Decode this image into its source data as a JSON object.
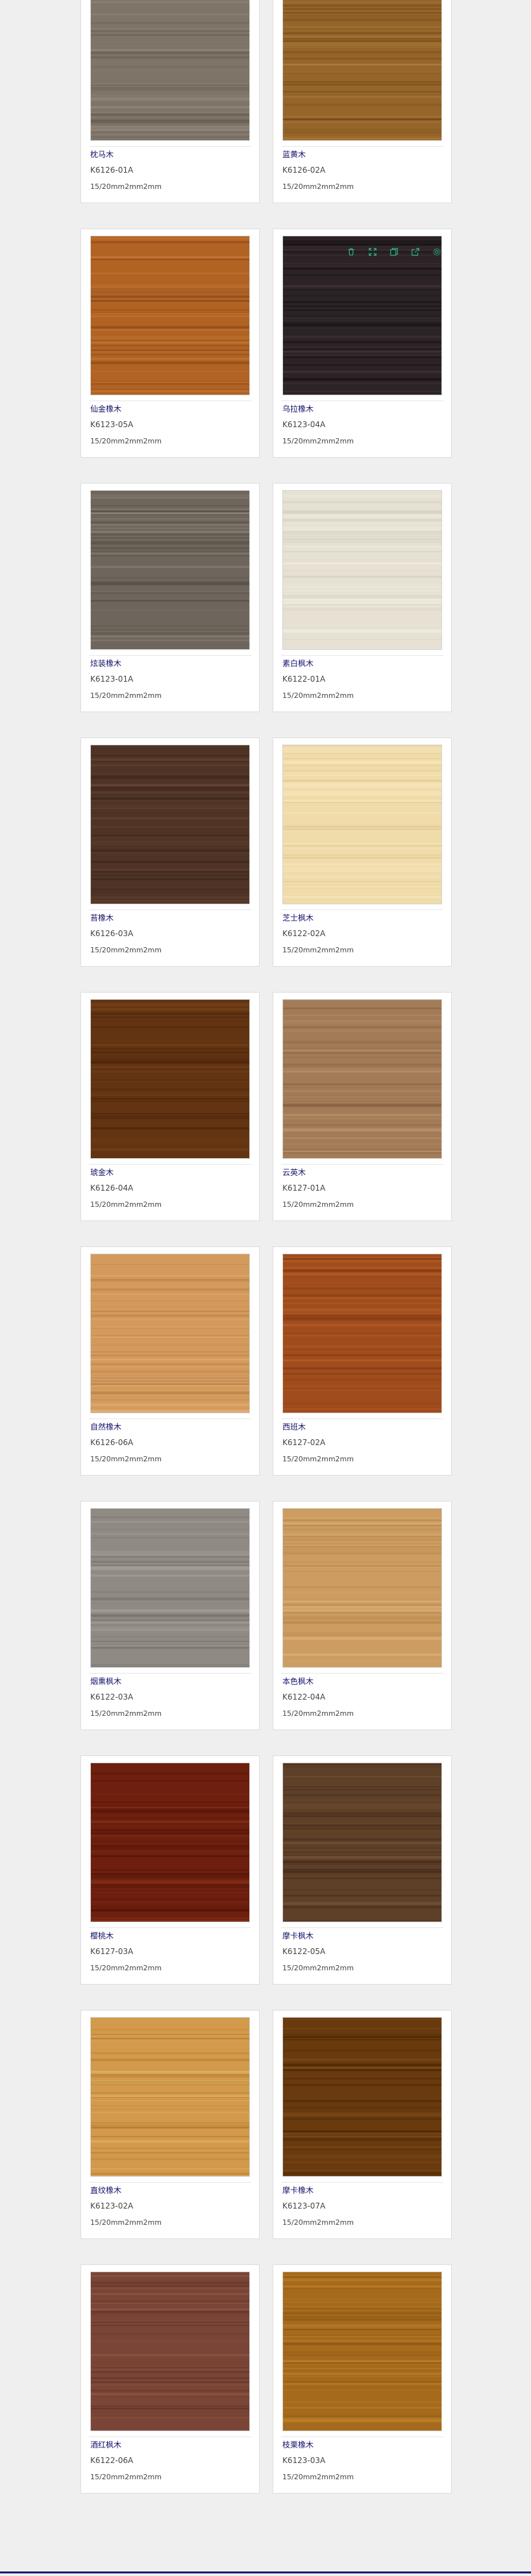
{
  "colors": {
    "accent": "#1c1a6e",
    "name_text": "#14126a",
    "toolbar_icon": "#2bb88a"
  },
  "toolbar": {
    "icons": [
      "trash-icon",
      "expand-icon",
      "copy-icon",
      "share-icon",
      "settings-icon"
    ]
  },
  "products": [
    {
      "name": "枕马木",
      "code": "K6126-01A",
      "spec": "15/20mm2mm2mm",
      "swatch": {
        "base": "#7e7468",
        "light": "#9a8f82",
        "dark": "#5e554b"
      }
    },
    {
      "name": "蓝黄木",
      "code": "K6126-02A",
      "spec": "15/20mm2mm2mm",
      "swatch": {
        "base": "#96652a",
        "light": "#b17e3c",
        "dark": "#6d4718"
      }
    },
    {
      "name": "仙金橡木",
      "code": "K6123-05A",
      "spec": "15/20mm2mm2mm",
      "swatch": {
        "base": "#b16324",
        "light": "#cb7c37",
        "dark": "#86461a"
      }
    },
    {
      "name": "乌拉橡木",
      "code": "K6123-04A",
      "spec": "15/20mm2mm2mm",
      "swatch": {
        "base": "#2b2325",
        "light": "#48383b",
        "dark": "#151011"
      }
    },
    {
      "name": "炫装橡木",
      "code": "K6123-01A",
      "spec": "15/20mm2mm2mm",
      "swatch": {
        "base": "#6e665c",
        "light": "#8c8378",
        "dark": "#514a42"
      }
    },
    {
      "name": "素白枫木",
      "code": "K6122-01A",
      "spec": "15/20mm2mm2mm",
      "swatch": {
        "base": "#e6e1d3",
        "light": "#f2eee4",
        "dark": "#d4cdbb"
      }
    },
    {
      "name": "苔橡木",
      "code": "K6126-03A",
      "spec": "15/20mm2mm2mm",
      "swatch": {
        "base": "#4f3426",
        "light": "#6a4634",
        "dark": "#362218"
      }
    },
    {
      "name": "芝士枫木",
      "code": "K6122-02A",
      "spec": "15/20mm2mm2mm",
      "swatch": {
        "base": "#f0dcaa",
        "light": "#f8ebc6",
        "dark": "#e1c58e"
      }
    },
    {
      "name": "琥金木",
      "code": "K6126-04A",
      "spec": "15/20mm2mm2mm",
      "swatch": {
        "base": "#633412",
        "light": "#7d461c",
        "dark": "#48240a"
      }
    },
    {
      "name": "云英木",
      "code": "K6127-01A",
      "spec": "15/20mm2mm2mm",
      "swatch": {
        "base": "#a37c57",
        "light": "#bb9670",
        "dark": "#7f5e3f"
      }
    },
    {
      "name": "自然橡木",
      "code": "K6126-06A",
      "spec": "15/20mm2mm2mm",
      "swatch": {
        "base": "#d39a5c",
        "light": "#e3b27a",
        "dark": "#b47c43"
      }
    },
    {
      "name": "西班木",
      "code": "K6127-02A",
      "spec": "15/20mm2mm2mm",
      "swatch": {
        "base": "#a14c1c",
        "light": "#ba6228",
        "dark": "#7a3512"
      }
    },
    {
      "name": "烟熏枫木",
      "code": "K6122-03A",
      "spec": "15/20mm2mm2mm",
      "swatch": {
        "base": "#908a84",
        "light": "#aaa49e",
        "dark": "#746e68"
      }
    },
    {
      "name": "本色枫木",
      "code": "K6122-04A",
      "spec": "15/20mm2mm2mm",
      "swatch": {
        "base": "#cc9c60",
        "light": "#dcb27a",
        "dark": "#b07f45"
      }
    },
    {
      "name": "樱桃木",
      "code": "K6127-03A",
      "spec": "15/20mm2mm2mm",
      "swatch": {
        "base": "#6e1f0e",
        "light": "#8c3218",
        "dark": "#4f1208"
      }
    },
    {
      "name": "摩卡枫木",
      "code": "K6122-05A",
      "spec": "15/20mm2mm2mm",
      "swatch": {
        "base": "#5e4028",
        "light": "#7a5638",
        "dark": "#42291a"
      }
    },
    {
      "name": "直纹橡木",
      "code": "K6123-02A",
      "spec": "15/20mm2mm2mm",
      "swatch": {
        "base": "#d29a4a",
        "light": "#e2b466",
        "dark": "#b27b30"
      }
    },
    {
      "name": "摩卡橡木",
      "code": "K6123-07A",
      "spec": "15/20mm2mm2mm",
      "swatch": {
        "base": "#683a0e",
        "light": "#84501c",
        "dark": "#4a2706"
      }
    },
    {
      "name": "酒红枫木",
      "code": "K6122-06A",
      "spec": "15/20mm2mm2mm",
      "swatch": {
        "base": "#7a4536",
        "light": "#935a48",
        "dark": "#5c3124"
      }
    },
    {
      "name": "枝栗橡木",
      "code": "K6123-03A",
      "spec": "15/20mm2mm2mm",
      "swatch": {
        "base": "#a66a1c",
        "light": "#c0842e",
        "dark": "#7d4c10"
      }
    }
  ]
}
